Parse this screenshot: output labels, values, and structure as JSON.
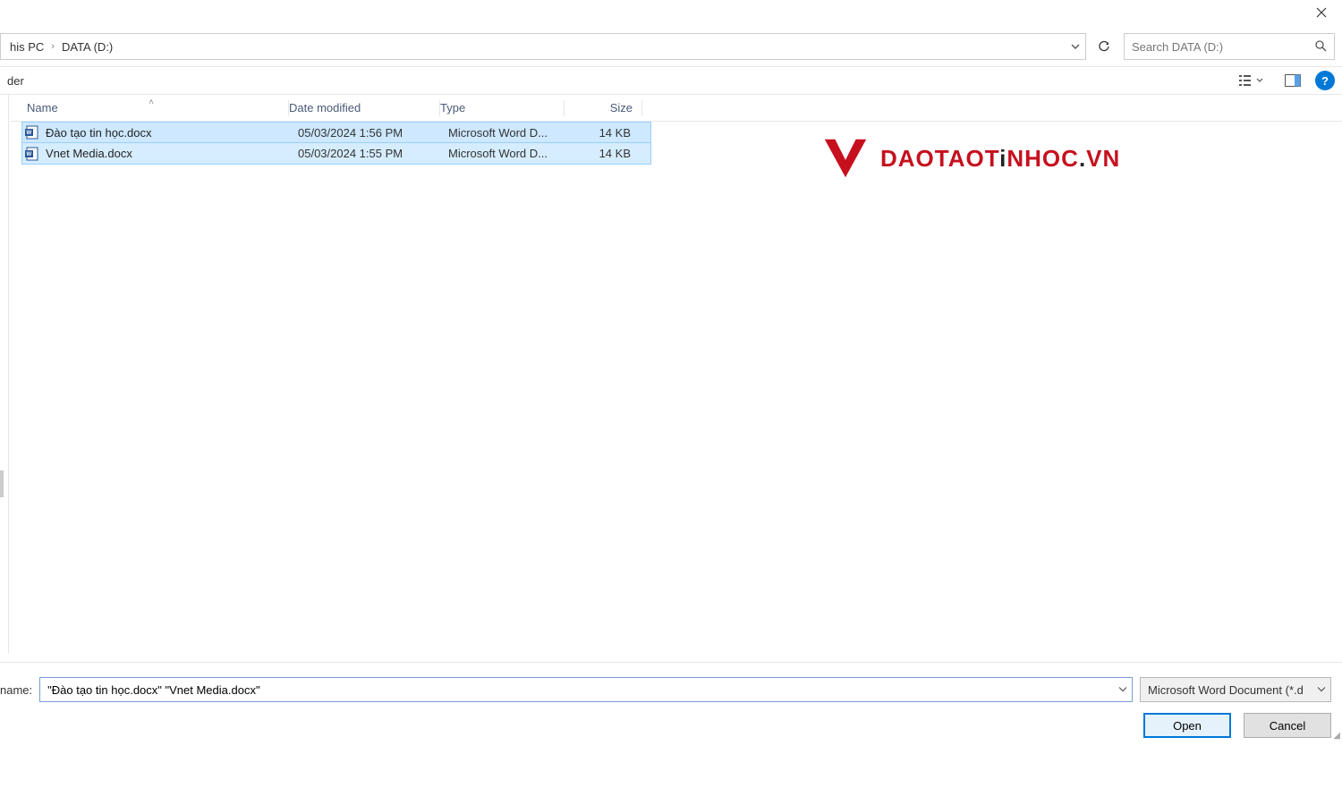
{
  "titlebar": {
    "close": "×"
  },
  "breadcrumb": {
    "item1": "his PC",
    "item2": "DATA (D:)"
  },
  "search": {
    "placeholder": "Search DATA (D:)"
  },
  "toolbar": {
    "leftLabel": "der"
  },
  "columns": {
    "name": "Name",
    "date": "Date modified",
    "type": "Type",
    "size": "Size"
  },
  "files": [
    {
      "name": "Đào tạo tin học.docx",
      "date": "05/03/2024 1:56 PM",
      "type": "Microsoft Word D...",
      "size": "14 KB"
    },
    {
      "name": "Vnet Media.docx",
      "date": "05/03/2024 1:55 PM",
      "type": "Microsoft Word D...",
      "size": "14 KB"
    }
  ],
  "watermark": {
    "text1": "DAOTAOT",
    "text2": "i",
    "text3": "NHOC",
    "text4": ".",
    "text5": "VN"
  },
  "bottom": {
    "filenameLabel": "name:",
    "filenameValue": "\"Đào tạo tin học.docx\" \"Vnet Media.docx\"",
    "filter": "Microsoft Word Document (*.d",
    "openBtn": "Open",
    "cancelBtn": "Cancel"
  }
}
